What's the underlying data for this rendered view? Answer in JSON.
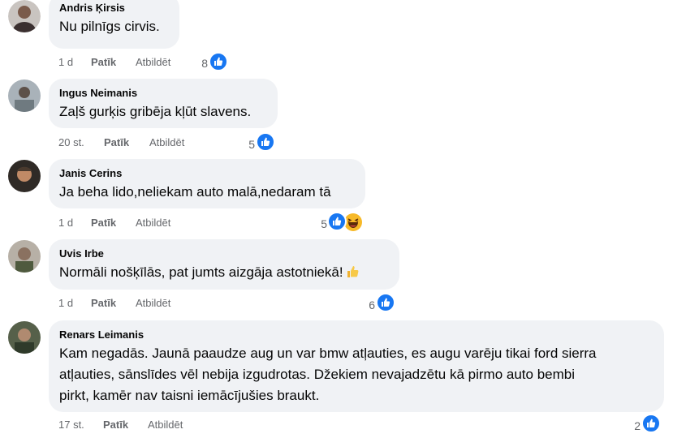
{
  "comments": [
    {
      "author": "Andris Ķirsis",
      "text": "Nu pilnīgs cirvis.",
      "time": "1 d",
      "like_label": "Patīk",
      "reply_label": "Atbildēt",
      "reaction_count": "8",
      "reactions": [
        "like-icon"
      ]
    },
    {
      "author": "Ingus Neimanis",
      "text": "Zaļš gurķis gribēja kļūt slavens.",
      "time": "20 st.",
      "like_label": "Patīk",
      "reply_label": "Atbildēt",
      "reaction_count": "5",
      "reactions": [
        "like-icon"
      ]
    },
    {
      "author": "Janis Cerins",
      "text": "Ja beha lido,neliekam auto malā,nedaram tā",
      "time": "1 d",
      "like_label": "Patīk",
      "reply_label": "Atbildēt",
      "reaction_count": "5",
      "reactions": [
        "like-icon",
        "haha-icon"
      ]
    },
    {
      "author": "Uvis Irbe",
      "text": "Normāli nošķīlās, pat jumts aizgāja astotniekā!",
      "time": "1 d",
      "like_label": "Patīk",
      "reply_label": "Atbildēt",
      "reaction_count": "6",
      "reactions": [
        "like-icon"
      ],
      "inline_emoji": "thumbs-up-icon"
    },
    {
      "author": "Renars Leimanis",
      "text_lines": [
        "Kam negadās. Jaunā paaudze aug un var bmw atļauties, es augu varēju tikai ford sierra",
        "atļauties, sānslīdes vēl nebija izgudrotas. Džekiem nevajadzētu kā pirmo auto bembi",
        "pirkt, kamēr nav taisni iemācījušies braukt."
      ],
      "time": "17 st.",
      "like_label": "Patīk",
      "reply_label": "Atbildēt",
      "reaction_count": "2",
      "reactions": [
        "like-icon"
      ]
    }
  ],
  "colors": {
    "bubble": "#f0f2f5",
    "like_blue": "#1877f2",
    "meta_text": "#65676b",
    "text": "#050505"
  }
}
